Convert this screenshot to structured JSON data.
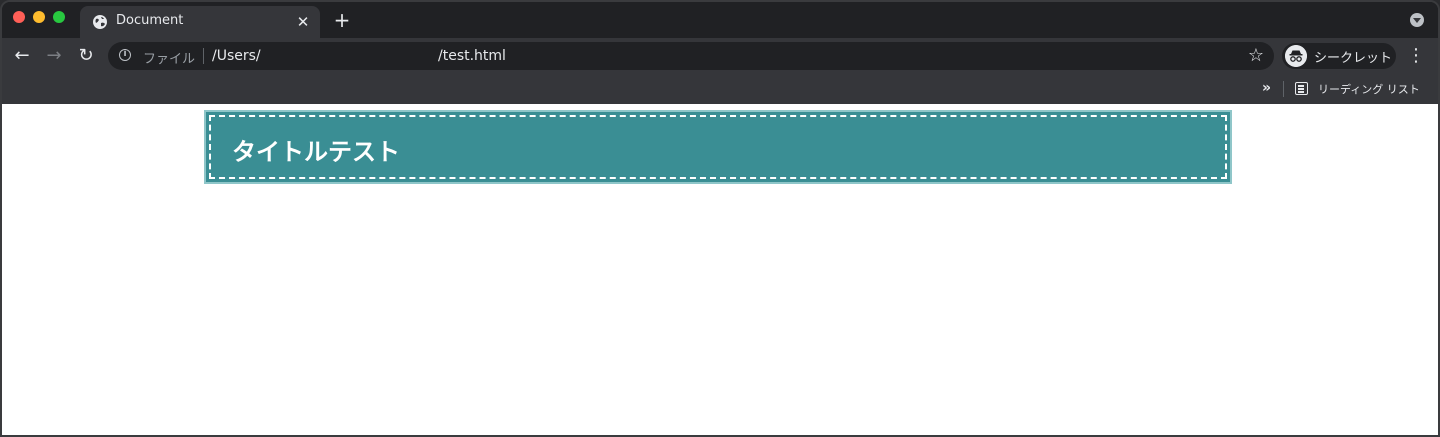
{
  "browser": {
    "tab": {
      "title": "Document",
      "close_label": "✕"
    },
    "new_tab_label": "+",
    "nav": {
      "back": "←",
      "forward": "→",
      "reload": "↻"
    },
    "omnibox": {
      "info_glyph": "i",
      "scheme_label": "ファイル",
      "path_start": "/Users/",
      "path_end": "/test.html",
      "star_glyph": "☆"
    },
    "profile": {
      "label": "シークレット"
    },
    "menu_glyph": "⋮",
    "bookmarks": {
      "overflow": "»",
      "reading_list_label": "リーディング リスト"
    }
  },
  "page": {
    "heading": "タイトルテスト",
    "colors": {
      "header_bg": "#3a8e94",
      "header_text": "#ffffff",
      "dashed_border": "#ffffff"
    }
  }
}
